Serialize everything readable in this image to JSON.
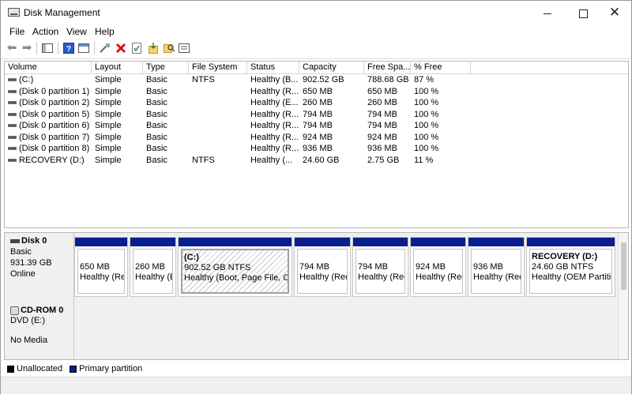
{
  "window": {
    "title": "Disk Management"
  },
  "menu": [
    "File",
    "Action",
    "View",
    "Help"
  ],
  "toolbar": [
    "back-icon",
    "forward-icon",
    "console-tree-icon",
    "help-icon",
    "properties-icon",
    "connect-icon",
    "delete-icon",
    "check-icon",
    "import-icon",
    "search-icon",
    "list-icon"
  ],
  "table": {
    "columns": [
      "Volume",
      "Layout",
      "Type",
      "File System",
      "Status",
      "Capacity",
      "Free Spa...",
      "% Free"
    ],
    "rows": [
      [
        "(C:)",
        "Simple",
        "Basic",
        "NTFS",
        "Healthy (B...",
        "902.52 GB",
        "788.68 GB",
        "87 %"
      ],
      [
        "(Disk 0 partition 1)",
        "Simple",
        "Basic",
        "",
        "Healthy (R...",
        "650 MB",
        "650 MB",
        "100 %"
      ],
      [
        "(Disk 0 partition 2)",
        "Simple",
        "Basic",
        "",
        "Healthy (E...",
        "260 MB",
        "260 MB",
        "100 %"
      ],
      [
        "(Disk 0 partition 5)",
        "Simple",
        "Basic",
        "",
        "Healthy (R...",
        "794 MB",
        "794 MB",
        "100 %"
      ],
      [
        "(Disk 0 partition 6)",
        "Simple",
        "Basic",
        "",
        "Healthy (R...",
        "794 MB",
        "794 MB",
        "100 %"
      ],
      [
        "(Disk 0 partition 7)",
        "Simple",
        "Basic",
        "",
        "Healthy (R...",
        "924 MB",
        "924 MB",
        "100 %"
      ],
      [
        "(Disk 0 partition 8)",
        "Simple",
        "Basic",
        "",
        "Healthy (R...",
        "936 MB",
        "936 MB",
        "100 %"
      ],
      [
        "RECOVERY (D:)",
        "Simple",
        "Basic",
        "NTFS",
        "Healthy (...",
        "24.60 GB",
        "2.75 GB",
        "11 %"
      ]
    ]
  },
  "disk0": {
    "name": "Disk 0",
    "type": "Basic",
    "size": "931.39 GB",
    "state": "Online",
    "partitions": [
      {
        "title": "",
        "size": "650 MB",
        "status": "Healthy (Rec"
      },
      {
        "title": "",
        "size": "260 MB",
        "status": "Healthy (E"
      },
      {
        "title": "(C:)",
        "size": "902.52 GB NTFS",
        "status": "Healthy (Boot, Page File, Crash"
      },
      {
        "title": "",
        "size": "794 MB",
        "status": "Healthy (Rec"
      },
      {
        "title": "",
        "size": "794 MB",
        "status": "Healthy (Rec"
      },
      {
        "title": "",
        "size": "924 MB",
        "status": "Healthy (Reco"
      },
      {
        "title": "",
        "size": "936 MB",
        "status": "Healthy (Reco"
      },
      {
        "title": "RECOVERY (D:)",
        "size": "24.60 GB NTFS",
        "status": "Healthy (OEM Partition"
      }
    ]
  },
  "cdrom": {
    "name": "CD-ROM 0",
    "type": "DVD (E:)",
    "state": "No Media"
  },
  "legend": {
    "unallocated": "Unallocated",
    "primary": "Primary partition",
    "unallocated_color": "#000000",
    "primary_color": "#0a1f8f"
  }
}
